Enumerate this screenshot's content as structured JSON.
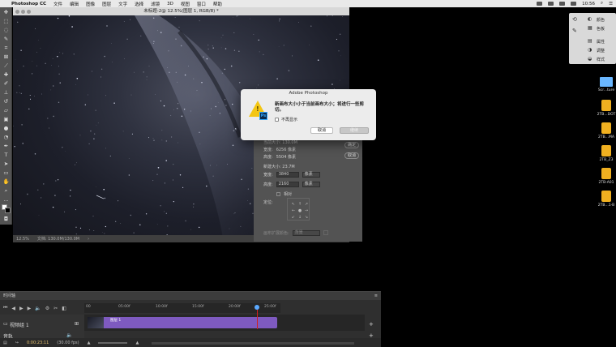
{
  "menubar": {
    "app_name": "Photoshop CC",
    "items": [
      "文件",
      "编辑",
      "图像",
      "图层",
      "文字",
      "选择",
      "滤镜",
      "3D",
      "视图",
      "窗口",
      "帮助"
    ],
    "right_time": "10:56"
  },
  "document": {
    "title": "未标题-2@ 12.5%(图层 1, RGB/8) *",
    "zoom": "12.5%",
    "doc_info": "文档: 130.0M/130.0M"
  },
  "dock_panel": {
    "items": [
      "颜色",
      "色板",
      "属性",
      "调整",
      "样式"
    ]
  },
  "desktop_icons": [
    {
      "label": "Scr...ture",
      "kind": "folder"
    },
    {
      "label": "2TB...DOT",
      "kind": "drive"
    },
    {
      "label": "2TB...MA",
      "kind": "drive"
    },
    {
      "label": "2TB_Z3",
      "kind": "drive"
    },
    {
      "label": "2TB-A01",
      "kind": "drive"
    },
    {
      "label": "2TB...1-B",
      "kind": "drive"
    }
  ],
  "canvas_size_dialog": {
    "current_label": "当前大小: 130.0M",
    "width_label": "宽度:",
    "width_value": "6256 像素",
    "height_label": "高度:",
    "height_value": "5504 像素",
    "new_size_label": "新建大小: 23.7M",
    "new_width_label": "宽度:",
    "new_width_value": "3840",
    "new_width_unit": "像素",
    "new_height_label": "高度:",
    "new_height_value": "2160",
    "new_height_unit": "像素",
    "relative_label": "相对",
    "anchor_label": "定位:",
    "extension_label": "画布扩展颜色:",
    "extension_value": "背景",
    "ok_label": "确定",
    "cancel_label": "取消"
  },
  "alert": {
    "title": "Adobe Photoshop",
    "message": "新画布大小小于当前画布大小；将进行一些剪切。",
    "checkbox_label": "不再显示",
    "cancel_label": "取消",
    "continue_label": "继续",
    "ps_badge": "Ps"
  },
  "timeline": {
    "panel_title": "时间轴",
    "ruler_ticks": [
      "00",
      "05:00f",
      "10:00f",
      "15:00f",
      "20:00f",
      "25:00f"
    ],
    "track_name": "视频组 1",
    "clip_name": "图层 1",
    "audio_track": "音轨",
    "timecode": "0:00:23:11",
    "fps": "(30.00 fps)"
  },
  "colors": {
    "accent": "#7e5ac0",
    "playhead": "#d02020",
    "panel_bg": "#535353"
  }
}
